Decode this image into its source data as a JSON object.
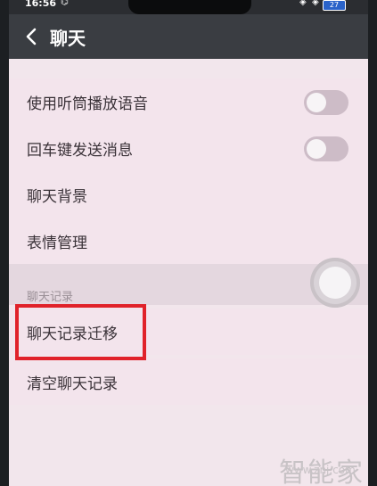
{
  "status_bar": {
    "time": "16:56",
    "battery": "27"
  },
  "header": {
    "title": "聊天"
  },
  "settings": [
    {
      "label": "使用听筒播放语音",
      "toggle": "off"
    },
    {
      "label": "回车键发送消息",
      "toggle": "off"
    },
    {
      "label": "聊天背景"
    },
    {
      "label": "表情管理"
    }
  ],
  "section_header": "聊天记录",
  "history_items": [
    {
      "label": "聊天记录迁移",
      "highlighted": true
    },
    {
      "label": "清空聊天记录"
    }
  ],
  "watermark": {
    "text": "智能家",
    "url": "www.znj.com"
  },
  "colors": {
    "highlight": "#e0222a",
    "background": "#f3e4ec"
  }
}
